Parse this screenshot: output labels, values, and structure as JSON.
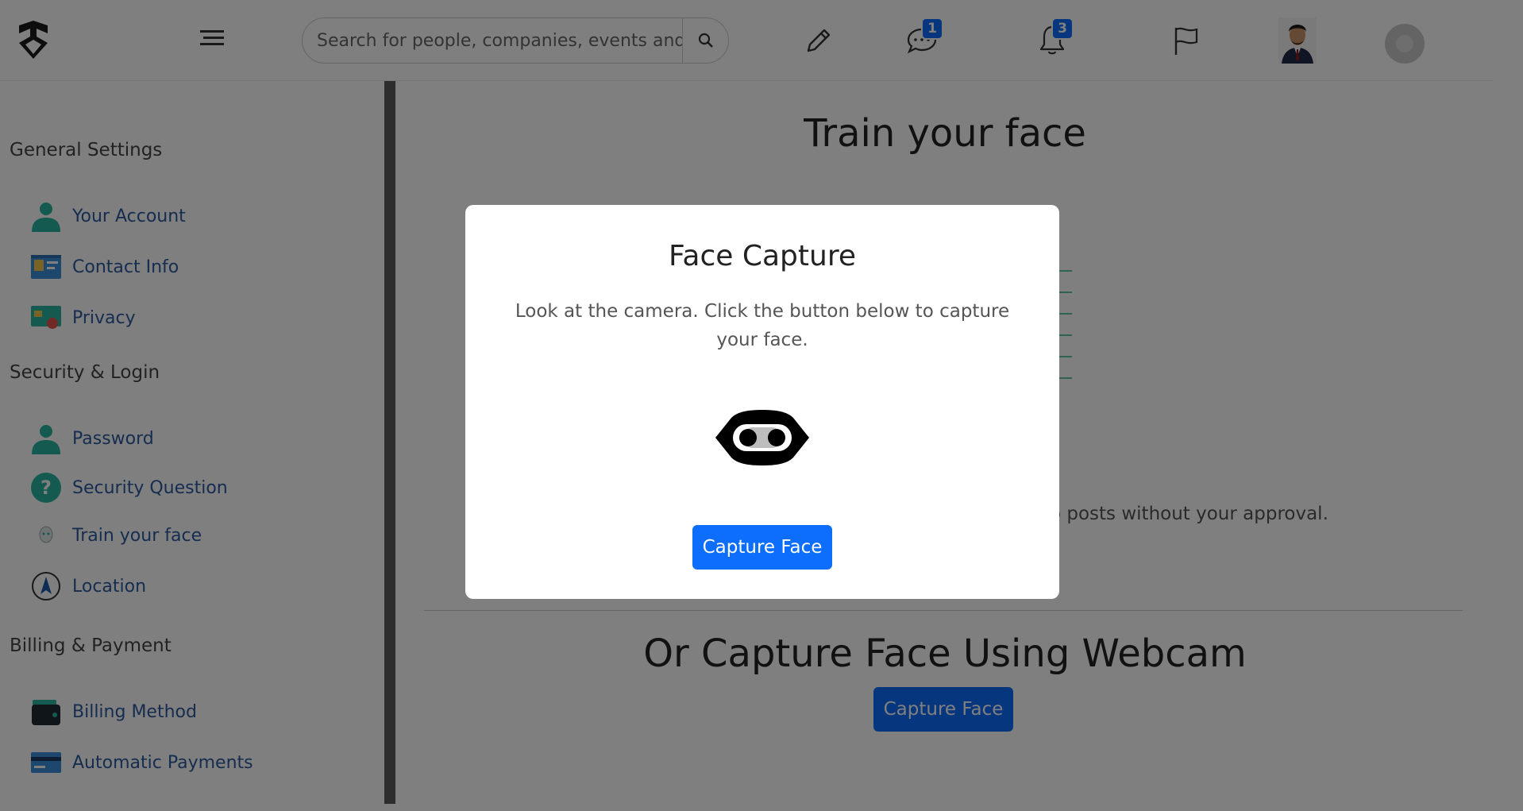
{
  "header": {
    "search_placeholder": "Search for people, companies, events and",
    "messages_badge": "1",
    "notifications_badge": "3"
  },
  "sidebar": {
    "sections": [
      {
        "title": "General Settings"
      },
      {
        "title": "Security & Login"
      },
      {
        "title": "Billing & Payment"
      }
    ],
    "items": [
      {
        "label": "Your Account",
        "icon": "user-icon"
      },
      {
        "label": "Contact Info",
        "icon": "id-card-icon"
      },
      {
        "label": "Privacy",
        "icon": "privacy-card-icon"
      },
      {
        "label": "Password",
        "icon": "user-icon"
      },
      {
        "label": "Security Question",
        "icon": "question-icon"
      },
      {
        "label": "Train your face",
        "icon": "face-icon"
      },
      {
        "label": "Location",
        "icon": "location-icon"
      },
      {
        "label": "Billing Method",
        "icon": "wallet-icon"
      },
      {
        "label": "Automatic Payments",
        "icon": "credit-card-icon"
      }
    ]
  },
  "main": {
    "title": "Train your face",
    "partial_text": "o posts without your approval.",
    "webcam_title": "Or Capture Face Using Webcam",
    "webcam_button": "Capture Face"
  },
  "modal": {
    "title": "Face Capture",
    "text": "Look at the camera. Click the button below to capture your face.",
    "button": "Capture Face"
  },
  "colors": {
    "accent": "#0d6efd",
    "link": "#2c5aa0",
    "teal": "#2bb5a0"
  }
}
